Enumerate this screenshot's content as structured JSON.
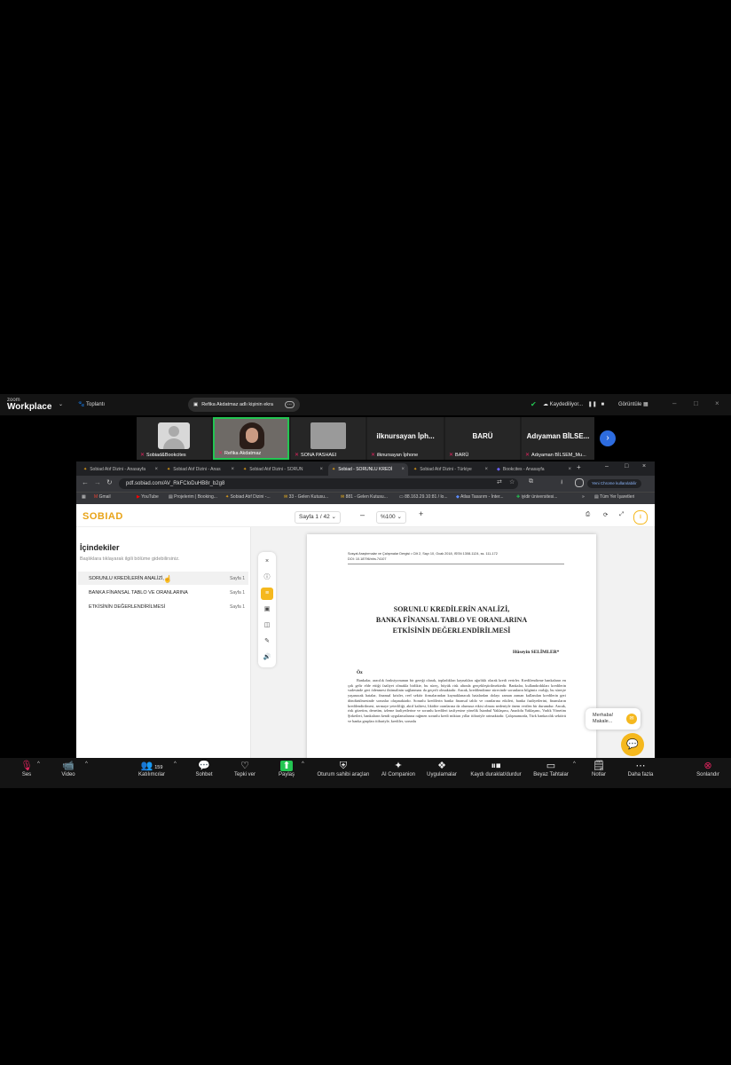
{
  "zoom": {
    "brand_top": "zoom",
    "brand_bottom": "Workplace",
    "meeting_label": "Toplantı",
    "share_notice": "Refika Akdatmaz adlı kişinin ekra",
    "recording_label": "Kaydediliyor...",
    "view_label": "Görüntüle",
    "participants": [
      {
        "name": "Sobiad&Bookcites",
        "type": "avatar"
      },
      {
        "name": "Refika Akdatmaz",
        "type": "video",
        "active": true
      },
      {
        "name": "SONA PASHAEI",
        "type": "photo"
      },
      {
        "name": "ilknursayan İphone",
        "big": "ilknursayan İph..."
      },
      {
        "name": "BARÜ",
        "big": "BARÜ"
      },
      {
        "name": "Adıyaman BİLSEM_Mu...",
        "big": "Adıyaman BİLSE..."
      }
    ],
    "toolbar": [
      {
        "label": "Ses",
        "icon": "mic-off-icon"
      },
      {
        "label": "Video",
        "icon": "video-off-icon"
      },
      {
        "label": "Katılımcılar",
        "icon": "participants-icon",
        "count": "159"
      },
      {
        "label": "Sohbet",
        "icon": "chat-icon"
      },
      {
        "label": "Tepki ver",
        "icon": "heart-icon"
      },
      {
        "label": "Paylaş",
        "icon": "share-icon"
      },
      {
        "label": "Oturum sahibi araçları",
        "icon": "shield-icon"
      },
      {
        "label": "AI Companion",
        "icon": "sparkle-icon"
      },
      {
        "label": "Uygulamalar",
        "icon": "apps-icon"
      },
      {
        "label": "Kaydı duraklat/durdur",
        "icon": "record-icon"
      },
      {
        "label": "Beyaz Tahtalar",
        "icon": "whiteboard-icon"
      },
      {
        "label": "Notlar",
        "icon": "notes-icon"
      },
      {
        "label": "Daha fazla",
        "icon": "more-icon"
      },
      {
        "label": "Sonlandır",
        "icon": "end-icon"
      }
    ]
  },
  "browser": {
    "tabs": [
      "Sobiad Atıf Dizini - Anasayfa",
      "Sobiad Atıf Dizini - Anas",
      "Sobiad Atıf Dizini - SORUN",
      "Sobiad - SORUNLU KREDİ",
      "Sobiad Atıf Dizini - Türkiye",
      "Bookcites - Anasayfa"
    ],
    "url": "pdf.sobiad.com/AV_RkFCloDuHB8r_b2g8",
    "chrome_update": "Yeni Chrome kullanılabilir",
    "bookmarks": [
      "Gmail",
      "YouTube",
      "Projelerim | Booking...",
      "Sobiad Atıf Dizini -...",
      "33 - Gelen Kutusu...",
      "881 - Gelen Kutusu...",
      "88.163.29.10:81 / lo...",
      "Atlas Tasarım - İnter...",
      "iyidir üniversitesi..."
    ],
    "all_bookmarks": "Tüm Yer İşaretleri"
  },
  "pdf": {
    "logo": "SOBIAD",
    "page_indicator": "Sayfa 1 / 42",
    "zoom": "%100",
    "toc_title": "İçindekiler",
    "toc_hint": "Başlıklara tıklayarak ilgili bölüme gidebilirsiniz.",
    "toc": [
      {
        "title": "SORUNLU KREDİLERİN ANALİZİ,",
        "page": "Sayfa 1",
        "selected": true
      },
      {
        "title": "BANKA FİNANSAL TABLO VE ORANLARINA",
        "page": "Sayfa 1"
      },
      {
        "title": "ETKİSİNİN DEĞERLENDİRİLMESİ",
        "page": "Sayfa 1"
      }
    ],
    "journal_line": "Sosyal Araştırmalar ve Çalışmalar Dergisi • Cilt 2, Sayı 10, Ocak 2018, ISSN 1308-1124, ss. 111-172",
    "doi": "DOI: 10.18796/nhs.74107",
    "title_lines": [
      "SORUNLU KREDİLERİN ANALİZİ,",
      "BANKA FİNANSAL TABLO VE ORANLARINA",
      "ETKİSİNİN DEĞERLENDİRİLMESİ"
    ],
    "author": "Hüseyin SELİMLER*",
    "abstract_heading": "Öz",
    "abstract": "Bankalar, aracılık fonksiyonunun bir gereği olarak, topladıkları kaynakları ağırlıklı olarak kredi verirler. Kredilendirme bankaların en çok gelir elde ettiği faaliyet olmakla birlikte, bu süreç, büyük risk altında gerçekleştirilmektedir. Bankalar, kullandırdıkları kredilerin vadesinde geri ödenmesi ihtimalinin sağlanması da geçerli olmaktadır. Ancak, kredilendirme sürecinde sorunların bilgimiz varlığı, bu süreçte yaşanacak hatalar, finansal krizler, reel sektör firmalarından kaynaklanacak hatalardan dolayı zaman zaman kullanılan kredilerin geri döndürülmesinde sorunlar oluşmaktadır. Sorunlu kredilerin banka finansal tablo ve oranlarına etkileri, banka faaliyetlerini, finansların kredilendirilmesi, sermaye yeterliliği, aktif kalitesi, likidite oranlarına da olumsuz etkisi olması nedeniyle önem verilen bir durumdur. Ancak, risk gözetim, denetim, izleme faaliyetlerine ve sorunlu kredileri tasfiyesine yönelik İstanbul Yaklaşımı, Anadolu Yaklaşımı, Varlık Yönetim Şirketleri, bankaların kendi uygulamalarına rağmen sorunlu kredi miktarı yıllar itibariyle artmaktadır. Çalışmamızda, Türk bankacılık sektörü ve banka grupları itibariyle, krediler, sorunlu",
    "chat_card": "Merhaba! Makale..."
  }
}
